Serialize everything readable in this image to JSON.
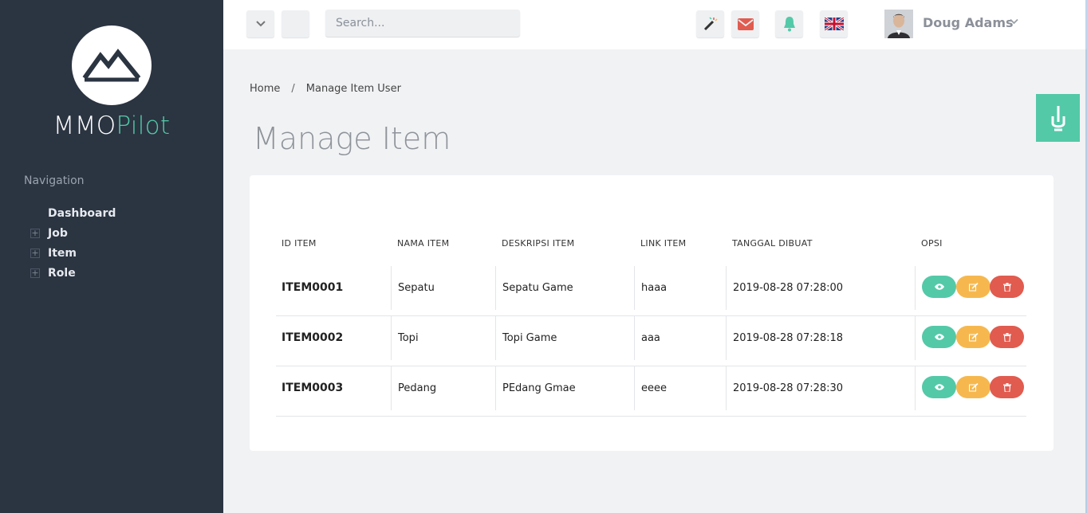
{
  "brand": {
    "part1": "MMO",
    "part2": "Pilot"
  },
  "nav": {
    "heading": "Navigation",
    "items": [
      {
        "label": "Dashboard",
        "expandable": false
      },
      {
        "label": "Job",
        "expandable": true
      },
      {
        "label": "Item",
        "expandable": true
      },
      {
        "label": "Role",
        "expandable": true
      }
    ],
    "expand_symbol": "+"
  },
  "topbar": {
    "search_placeholder": "Search...",
    "user_name": "Doug Adams"
  },
  "breadcrumb": {
    "home": "Home",
    "separator": "/",
    "current": "Manage Item User"
  },
  "page": {
    "title": "Manage Item"
  },
  "table": {
    "columns": [
      "ID ITEM",
      "NAMA ITEM",
      "DESKRIPSI ITEM",
      "LINK ITEM",
      "TANGGAL DIBUAT",
      "OPSI"
    ],
    "rows": [
      {
        "id": "ITEM0001",
        "name": "Sepatu",
        "desc": "Sepatu Game",
        "link": "haaa",
        "date": "2019-08-28 07:28:00"
      },
      {
        "id": "ITEM0002",
        "name": "Topi",
        "desc": "Topi Game",
        "link": "aaa",
        "date": "2019-08-28 07:28:18"
      },
      {
        "id": "ITEM0003",
        "name": "Pedang",
        "desc": "PEdang Gmae",
        "link": "eeee",
        "date": "2019-08-28 07:28:30"
      }
    ]
  },
  "colors": {
    "sidebar": "#2b3441",
    "accent": "#53c9a8",
    "warning": "#f6b84e",
    "danger": "#e15b4f",
    "mail": "#e15b4f"
  }
}
